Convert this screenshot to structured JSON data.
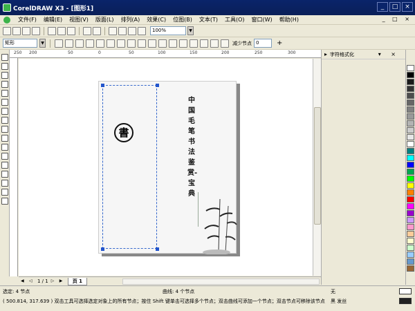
{
  "window": {
    "title": "CorelDRAW X3 - [图形1]"
  },
  "menu": [
    "文件(F)",
    "编辑(E)",
    "视图(V)",
    "版面(L)",
    "排列(A)",
    "效果(C)",
    "位图(B)",
    "文本(T)",
    "工具(O)",
    "窗口(W)",
    "帮助(H)"
  ],
  "toolbar": {
    "zoom": "100%"
  },
  "propertybar": {
    "shape": "矩形",
    "reduce_label": "减少节点",
    "reduce_value": "0"
  },
  "ruler": {
    "top_labels": [
      "250",
      "200",
      "50",
      "0",
      "50",
      "100",
      "150",
      "200",
      "250",
      "300"
    ]
  },
  "document": {
    "vertical_title": "中国毛笔书法鉴赏-宝典",
    "seal_char": "書",
    "page_counter": "1 / 1",
    "page_tab": "页 1"
  },
  "docker": {
    "title": "字符格式化"
  },
  "palette": [
    "#ffffff",
    "#000000",
    "#1a1a1a",
    "#333333",
    "#4d4d4d",
    "#666666",
    "#808080",
    "#999999",
    "#b3b3b3",
    "#cccccc",
    "#e6e6e6",
    "#ffffff",
    "#008080",
    "#00ffff",
    "#0000ff",
    "#00a650",
    "#00ff00",
    "#ffff00",
    "#ff8000",
    "#ff0000",
    "#ff00ff",
    "#9900cc",
    "#cc99ff",
    "#ff99cc",
    "#ffcc99",
    "#ffffcc",
    "#ccffcc",
    "#99ccff",
    "#6699cc",
    "#996633"
  ],
  "status": {
    "selected": "选定: 4 节点",
    "curve": "曲线: 4 个节点",
    "coords_hint": "( 500.814, 317.639 )   双击工具可选择选定对象上的所有节点；按住 Shift 键单击可选择多个节点；双击曲线可添加一个节点；双击节点可移除该节点",
    "fill": "无",
    "outline": "黑 发丝"
  }
}
